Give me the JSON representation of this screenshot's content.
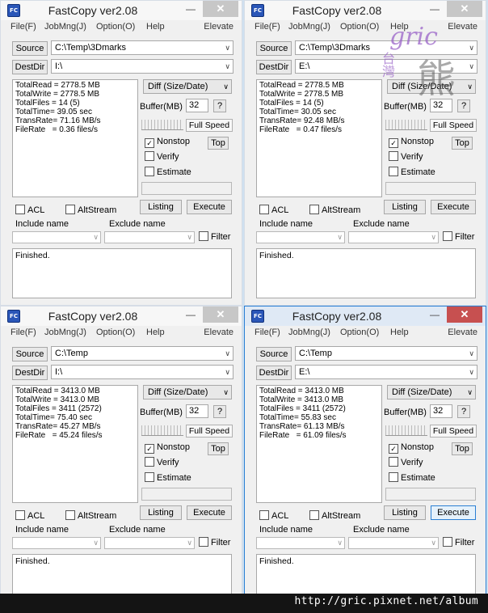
{
  "app": {
    "title": "FastCopy ver2.08",
    "icon_label": "FC",
    "minimize_glyph": "—",
    "close_glyph": "✕"
  },
  "menu": {
    "file": "File(F)",
    "jobmng": "JobMng(J)",
    "option": "Option(O)",
    "help": "Help",
    "elevate": "Elevate"
  },
  "labels": {
    "source": "Source",
    "destdir": "DestDir",
    "diff": "Diff (Size/Date)",
    "buffer": "Buffer(MB)",
    "buffer_value": "32",
    "help_q": "?",
    "full_speed": "Full Speed",
    "nonstop": "Nonstop",
    "top": "Top",
    "verify": "Verify",
    "estimate": "Estimate",
    "acl": "ACL",
    "altstream": "AltStream",
    "listing": "Listing",
    "execute": "Execute",
    "include_name": "Include name",
    "exclude_name": "Exclude name",
    "filter": "Filter",
    "finished": "Finished.",
    "check_mark": "✓",
    "arrow": "∨"
  },
  "windows": [
    {
      "source": "C:\\Temp\\3Dmarks",
      "dest": "I:\\",
      "stats": {
        "total_read": "TotalRead = 2778.5 MB",
        "total_write": "TotalWrite = 2778.5 MB",
        "total_files": "TotalFiles = 14 (5)",
        "total_time": "TotalTime= 39.05 sec",
        "trans_rate": "TransRate= 71.16 MB/s",
        "file_rate": "FileRate   = 0.36 files/s"
      }
    },
    {
      "source": "C:\\Temp\\3Dmarks",
      "dest": "E:\\",
      "stats": {
        "total_read": "TotalRead = 2778.5 MB",
        "total_write": "TotalWrite = 2778.5 MB",
        "total_files": "TotalFiles = 14 (5)",
        "total_time": "TotalTime= 30.05 sec",
        "trans_rate": "TransRate= 92.48 MB/s",
        "file_rate": "FileRate   = 0.47 files/s"
      }
    },
    {
      "source": "C:\\Temp",
      "dest": "I:\\",
      "stats": {
        "total_read": "TotalRead = 3413.0 MB",
        "total_write": "TotalWrite = 3413.0 MB",
        "total_files": "TotalFiles = 3411 (2572)",
        "total_time": "TotalTime= 75.40 sec",
        "trans_rate": "TransRate= 45.27 MB/s",
        "file_rate": "FileRate   = 45.24 files/s"
      }
    },
    {
      "source": "C:\\Temp",
      "dest": "E:\\",
      "stats": {
        "total_read": "TotalRead = 3413.0 MB",
        "total_write": "TotalWrite = 3413.0 MB",
        "total_files": "TotalFiles = 3411 (2572)",
        "total_time": "TotalTime= 55.83 sec",
        "trans_rate": "TransRate= 61.13 MB/s",
        "file_rate": "FileRate   = 61.09 files/s"
      }
    }
  ],
  "watermark": {
    "brand": "gric",
    "side_text": "台灣",
    "big_char": "熊"
  },
  "footer": {
    "url": "http://gric.pixnet.net/album"
  },
  "colors": {
    "active_border": "#2a7fd4",
    "close_active": "#c75050",
    "close_inactive": "#c7c7c7"
  }
}
